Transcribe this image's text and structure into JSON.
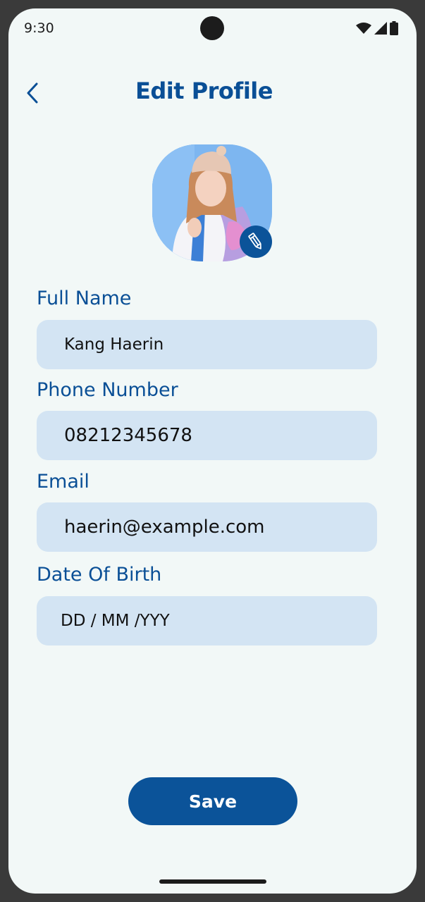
{
  "status_bar": {
    "time": "9:30",
    "icons": [
      "wifi-icon",
      "signal-icon",
      "battery-icon"
    ]
  },
  "header": {
    "back_icon": "chevron-left-icon",
    "title": "Edit Profile"
  },
  "avatar": {
    "edit_icon": "pencil-icon"
  },
  "form": {
    "full_name": {
      "label": "Full Name",
      "value": "Kang Haerin"
    },
    "phone": {
      "label": "Phone Number",
      "value": "08212345678"
    },
    "email": {
      "label": "Email",
      "value": "haerin@example.com"
    },
    "dob": {
      "label": "Date Of Birth",
      "placeholder": "DD / MM /YYY"
    }
  },
  "actions": {
    "save_label": "Save"
  },
  "colors": {
    "accent": "#0b5399",
    "title": "#0a4f96",
    "input_bg": "#d3e4f3",
    "page_bg": "#f2f8f7"
  }
}
